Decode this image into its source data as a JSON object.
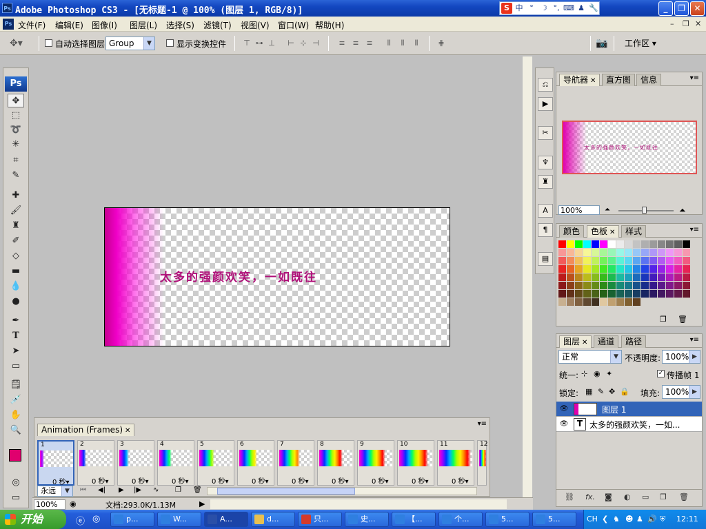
{
  "window": {
    "title": "Adobe Photoshop CS3 - [无标题-1 @ 100% (图层 1, RGB/8)]",
    "icon": "ps-app-icon"
  },
  "ime": {
    "labels": [
      "S",
      "中",
      "°",
      "☽",
      "°,",
      "⌨",
      "♟",
      "🔧"
    ]
  },
  "menu": [
    "文件(F)",
    "编辑(E)",
    "图像(I)",
    "图层(L)",
    "选择(S)",
    "滤镜(T)",
    "视图(V)",
    "窗口(W)",
    "帮助(H)"
  ],
  "options": {
    "auto_select_label": "自动选择图层",
    "auto_select_value": "Group",
    "show_transform_label": "显示变换控件",
    "workspace_label": "工作区 ▾"
  },
  "tools": [
    "move-tool",
    "marquee-tool",
    "lasso-tool",
    "magic-wand-tool",
    "crop-tool",
    "slice-tool",
    "healing-tool",
    "brush-tool",
    "stamp-tool",
    "history-brush-tool",
    "eraser-tool",
    "gradient-tool",
    "blur-tool",
    "dodge-tool",
    "pen-tool",
    "type-tool",
    "path-select-tool",
    "shape-tool",
    "notes-tool",
    "eyedropper-tool",
    "hand-tool",
    "zoom-tool"
  ],
  "colors": {
    "foreground": "#e0006e",
    "background": "#000000",
    "accent": "#3264b8"
  },
  "document": {
    "text": "太多的强颜欢笑，一如既往",
    "gradient": "#f000c8"
  },
  "navigator": {
    "tabs": [
      "导航器",
      "直方图",
      "信息"
    ],
    "zoom": "100%",
    "thumb_text": "太多的强颜欢笑，一如既往"
  },
  "swatches": {
    "tabs": [
      "颜色",
      "色板",
      "样式"
    ]
  },
  "layers": {
    "tabs": [
      "图层",
      "通道",
      "路径"
    ],
    "blend": "正常",
    "opacity_label": "不透明度:",
    "opacity": "100%",
    "unify_label": "统一:",
    "propagate_label": "传播帧 1",
    "lock_label": "锁定:",
    "fill_label": "填充:",
    "fill": "100%",
    "items": [
      {
        "name": "图层 1",
        "selected": true
      },
      {
        "name": "太多的强颜欢笑，一如...",
        "selected": false
      }
    ]
  },
  "animation": {
    "title": "Animation (Frames)",
    "loop": "永远",
    "frames": [
      {
        "n": "1",
        "delay": "0 秒▾"
      },
      {
        "n": "2",
        "delay": "0 秒▾"
      },
      {
        "n": "3",
        "delay": "0 秒▾"
      },
      {
        "n": "4",
        "delay": "0 秒▾"
      },
      {
        "n": "5",
        "delay": "0 秒▾"
      },
      {
        "n": "6",
        "delay": "0 秒▾"
      },
      {
        "n": "7",
        "delay": "0 秒▾"
      },
      {
        "n": "8",
        "delay": "0 秒▾"
      },
      {
        "n": "9",
        "delay": "0 秒▾"
      },
      {
        "n": "10",
        "delay": "0 秒▾"
      },
      {
        "n": "11",
        "delay": "0 秒▾"
      },
      {
        "n": "12",
        "delay": ""
      }
    ]
  },
  "status": {
    "zoom": "100%",
    "doc": "文档:293.0K/1.13M"
  },
  "taskbar": {
    "start": "开始",
    "tasks": [
      "p...",
      "W...",
      "A...",
      "d...",
      "只...",
      "史...",
      "【...",
      "个...",
      "5...",
      "5..."
    ],
    "lang": "CH",
    "clock": "12:11"
  }
}
